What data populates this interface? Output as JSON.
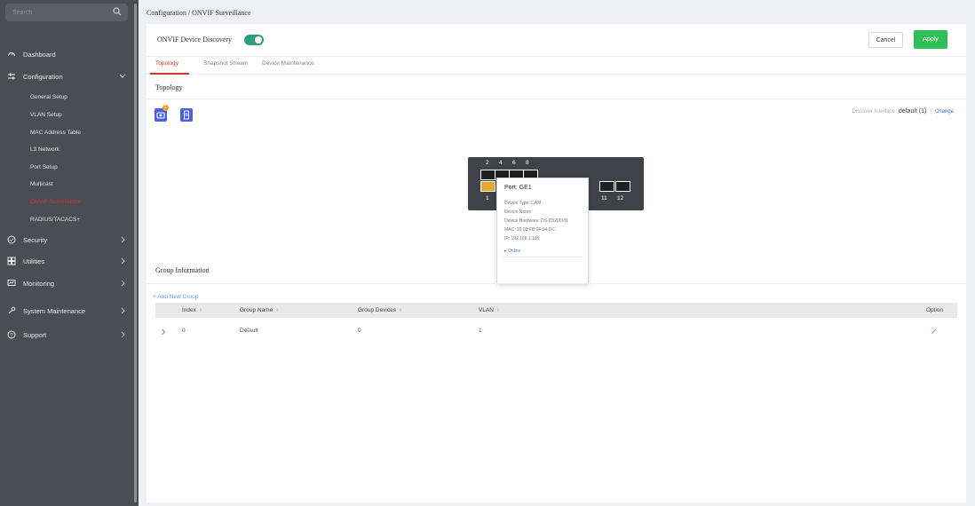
{
  "sidebar": {
    "search_placeholder": "Search",
    "dashboard": "Dashboard",
    "configuration": "Configuration",
    "sub_items": [
      "General Setup",
      "VLAN Setup",
      "MAC Address Table",
      "L3 Network",
      "Port Setup",
      "Multicast",
      "ONVIF Surveillance",
      "RADIUS/TACACS+"
    ],
    "security": "Security",
    "utilities": "Utilities",
    "monitoring": "Monitoring",
    "system_maintenance": "System Maintenance",
    "support": "Support"
  },
  "breadcrumb": "Configuration / ONVIF Surveillance",
  "topbar": {
    "discovery_label": "ONVIF Device Discovery",
    "toggle_on": true,
    "cancel": "Cancel",
    "apply": "Apply"
  },
  "tabs": [
    "Topology",
    "Snapshot Stream",
    "Device Maintenance"
  ],
  "topology": {
    "title": "Topology",
    "camera_badge": "1",
    "discover_label": "Discover Interface",
    "discover_value": "default (1)",
    "separator": "|",
    "change": "Change",
    "switch_top_ports": [
      "2",
      "4",
      "6",
      "8"
    ],
    "switch_bottom_ports": [
      "1",
      "11",
      "12"
    ]
  },
  "tooltip": {
    "title": "Port: GE1",
    "lines": [
      "Device Type: CAM",
      "Device Name:",
      "Device Hardware: DS-D3200VN",
      "MAC: 55:03:FB:0F:94:DC",
      "IP: 192.168.1.135"
    ],
    "online": "Online"
  },
  "group": {
    "title": "Group Information",
    "add": "+ Add New Group",
    "headers": [
      "Index",
      "Group Name",
      "Group Devices",
      "VLAN",
      "Option"
    ],
    "rows": [
      {
        "index": "0",
        "name": "Default",
        "devices": "0",
        "vlan": "1"
      }
    ]
  },
  "colors": {
    "accent": "#d1372e",
    "apply": "#2fbf57",
    "toggle": "#2f9e7d",
    "icon_blue": "#4a5fe6"
  }
}
